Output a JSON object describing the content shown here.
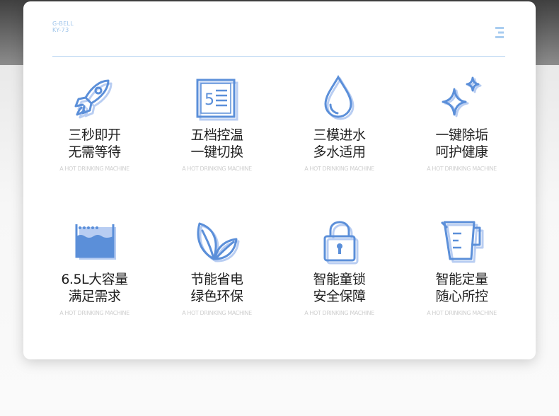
{
  "brand": {
    "line1": "G-BELL",
    "line2": "KY-73"
  },
  "colors": {
    "icon_stroke": "#5b8fd9",
    "icon_shadow": "#b8cdf2",
    "icon_fill": "#5b8fd9"
  },
  "features": [
    {
      "icon": "rocket-icon",
      "title_line1": "三秒即开",
      "title_line2": "无需等待",
      "subtitle": "A HOT DRINKING MACHINE"
    },
    {
      "icon": "five-levels-icon",
      "title_line1": "五档控温",
      "title_line2": "一键切换",
      "subtitle": "A HOT DRINKING MACHINE"
    },
    {
      "icon": "water-drop-icon",
      "title_line1": "三模进水",
      "title_line2": "多水适用",
      "subtitle": "A HOT DRINKING MACHINE"
    },
    {
      "icon": "sparkle-icon",
      "title_line1": "一键除垢",
      "title_line2": "呵护健康",
      "subtitle": "A HOT DRINKING MACHINE"
    },
    {
      "icon": "water-tank-icon",
      "title_line1": "6.5L大容量",
      "title_line2": "满足需求",
      "subtitle": "A HOT DRINKING MACHINE"
    },
    {
      "icon": "leaves-icon",
      "title_line1": "节能省电",
      "title_line2": "绿色环保",
      "subtitle": "A HOT DRINKING MACHINE"
    },
    {
      "icon": "padlock-icon",
      "title_line1": "智能童锁",
      "title_line2": "安全保障",
      "subtitle": "A HOT DRINKING MACHINE"
    },
    {
      "icon": "measuring-cup-icon",
      "title_line1": "智能定量",
      "title_line2": "随心所控",
      "subtitle": "A HOT DRINKING MACHINE"
    }
  ]
}
